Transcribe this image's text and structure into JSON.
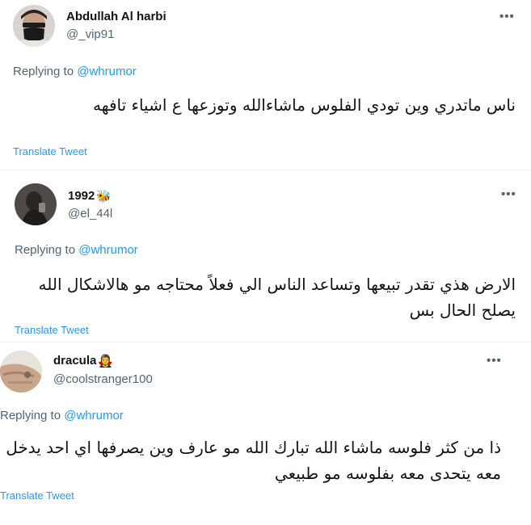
{
  "replying_label": "Replying to",
  "translate_label": "Translate Tweet",
  "more_label": "•••",
  "tweets": [
    {
      "name": "Abdullah Al harbi",
      "handle": "@_vip91",
      "reply_to": "@whrumor",
      "text": "ناس ماتدري وين تودي الفلوس ماشاءالله وتوزعها ع اشياء تافهه",
      "icon": "masked-person-avatar"
    },
    {
      "name": "1992",
      "name_emoji": "🐝",
      "handle": "@el_44l",
      "reply_to": "@whrumor",
      "text": "الارض هذي تقدر تبيعها وتساعد الناس الي فعلاً محتاجه مو هالاشكال الله يصلح الحال بس",
      "icon": "dark-photo-avatar"
    },
    {
      "name": "dracula",
      "name_emoji": "🧛‍♀️",
      "handle": "@coolstranger100",
      "reply_to": "@whrumor",
      "text": "ذا من كثر فلوسه ماشاء الله تبارك الله مو عارف وين يصرفها اي احد يدخل معه يتحدى معه بفلوسه مو طبيعي",
      "icon": "hand-photo-avatar"
    }
  ]
}
